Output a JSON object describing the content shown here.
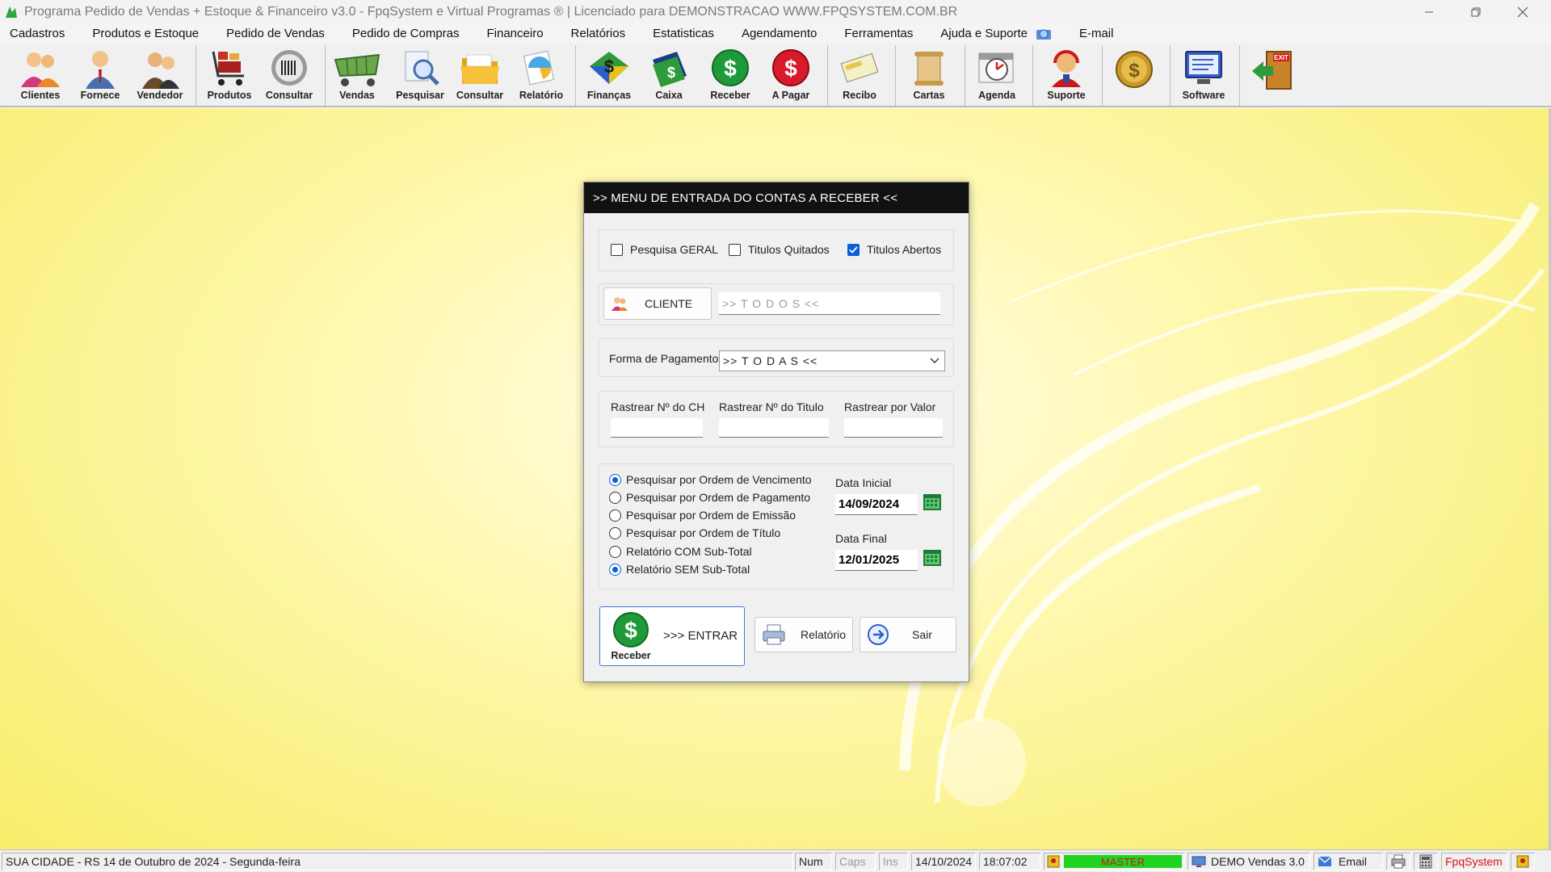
{
  "window": {
    "title": "Programa Pedido de Vendas + Estoque & Financeiro v3.0 - FpqSystem e Virtual Programas ® | Licenciado para  DEMONSTRACAO WWW.FPQSYSTEM.COM.BR"
  },
  "menu": {
    "items": [
      "Cadastros",
      "Produtos e Estoque",
      "Pedido de Vendas",
      "Pedido de Compras",
      "Financeiro",
      "Relatórios",
      "Estatisticas",
      "Agendamento",
      "Ferramentas",
      "Ajuda e Suporte",
      "E-mail"
    ]
  },
  "toolbar": {
    "clientes": "Clientes",
    "fornece": "Fornece",
    "vendedor": "Vendedor",
    "produtos": "Produtos",
    "consultar1": "Consultar",
    "vendas": "Vendas",
    "pesquisar": "Pesquisar",
    "consultar2": "Consultar",
    "relatorio": "Relatório",
    "financas": "Finanças",
    "caixa": "Caixa",
    "receber": "Receber",
    "apagar": "A Pagar",
    "recibo": "Recibo",
    "cartas": "Cartas",
    "agenda": "Agenda",
    "suporte": "Suporte",
    "software": "Software"
  },
  "dialog": {
    "title": ">>  MENU DE ENTRADA DO CONTAS A RECEBER  <<",
    "filters": {
      "pesquisa_geral": "Pesquisa GERAL",
      "titulos_quitados": "Titulos Quitados",
      "titulos_abertos": "Titulos Abertos"
    },
    "cliente": {
      "button": "CLIENTE",
      "value": ">> T O D O S <<"
    },
    "forma_pagamento": {
      "label": "Forma de Pagamento",
      "value": ">> T O D A S <<"
    },
    "rastrear": {
      "ch": "Rastrear Nº do CH",
      "titulo": "Rastrear Nº do Titulo",
      "valor": "Rastrear por Valor"
    },
    "ordem": {
      "vencimento": "Pesquisar por Ordem de Vencimento",
      "pagamento": "Pesquisar por Ordem de Pagamento",
      "emissao": "Pesquisar por Ordem de Emissão",
      "titulo": "Pesquisar por Ordem de Título",
      "com_subtotal": "Relatório COM Sub-Total",
      "sem_subtotal": "Relatório SEM Sub-Total"
    },
    "datas": {
      "inicial_label": "Data Inicial",
      "inicial": "14/09/2024",
      "final_label": "Data Final",
      "final": "12/01/2025"
    },
    "buttons": {
      "receber": "Receber",
      "entrar": ">>> ENTRAR",
      "relatorio": "Relatório",
      "sair": "Sair"
    }
  },
  "statusbar": {
    "location": "SUA CIDADE - RS 14 de Outubro de 2024 - Segunda-feira",
    "num": "Num",
    "caps": "Caps",
    "ins": "Ins",
    "date": "14/10/2024",
    "time": "18:07:02",
    "user": "MASTER",
    "version": "DEMO Vendas 3.0",
    "email": "Email",
    "brand": "FpqSystem"
  },
  "colors": {
    "accent": "#0a5fd6",
    "dialog_header": "#111111",
    "master_badge": "#21d321",
    "brand": "#e0101a"
  }
}
